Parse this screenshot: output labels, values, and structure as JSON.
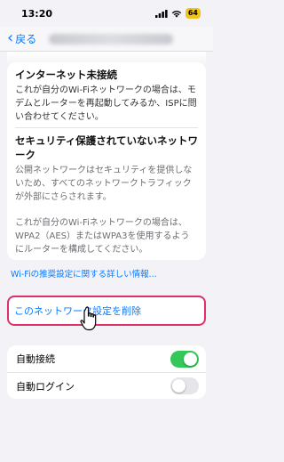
{
  "status_bar": {
    "time": "13:20",
    "battery": "64"
  },
  "nav": {
    "back_label": "戻る"
  },
  "info": {
    "sections": [
      {
        "title": "インターネット未接続",
        "body": "これが自分のWi-Fiネットワークの場合は、モデムとルーターを再起動してみるか、ISPに問い合わせてください。"
      },
      {
        "title": "セキュリティ保護されていないネットワーク",
        "body": "公開ネットワークはセキュリティを提供しないため、すべてのネットワークトラフィックが外部にさらされます。",
        "body2": "これが自分のWi-Fiネットワークの場合は、WPA2（AES）またはWPA3を使用するようにルーターを構成してください。"
      }
    ],
    "link": "Wi-Fiの推奨設定に関する詳しい情報..."
  },
  "forget_label": "このネットワーク設定を削除",
  "toggles": [
    {
      "label": "自動接続",
      "on": true
    },
    {
      "label": "自動ログイン",
      "on": false
    }
  ],
  "colors": {
    "accent": "#0a7aff",
    "highlight": "#e0306a",
    "toggle_on": "#34c759"
  }
}
